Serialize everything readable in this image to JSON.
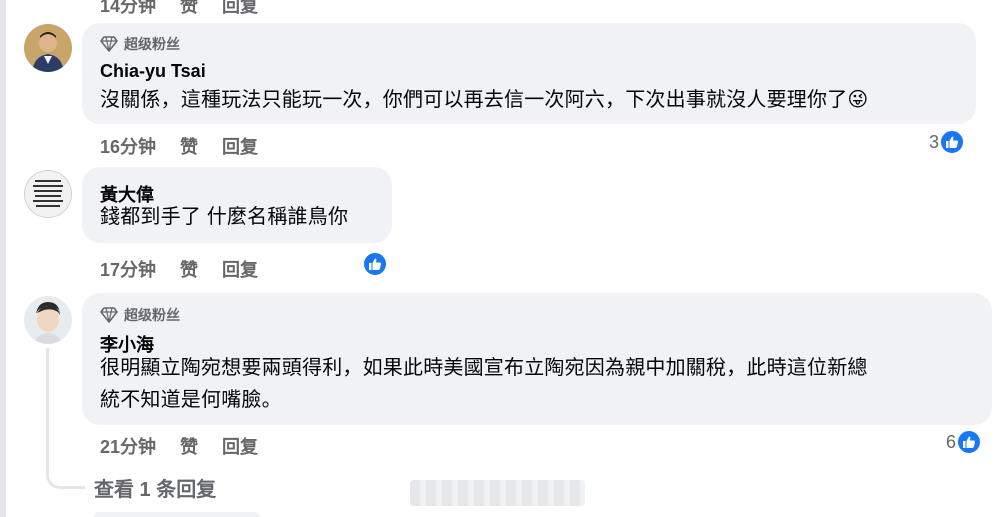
{
  "top_partial": {
    "time": "14分钟",
    "like": "赞",
    "reply": "回复"
  },
  "comments": [
    {
      "badge": "超级粉丝",
      "author": "Chia-yu Tsai",
      "text": "沒關係，這種玩法只能玩一次，你們可以再去信一次阿六，下次出事就沒人要理你了",
      "emoji": "😜",
      "time": "16分钟",
      "like": "赞",
      "reply": "回复",
      "reactions": "3"
    },
    {
      "author": "黃大偉",
      "text": "錢都到手了 什麼名稱誰鳥你",
      "time": "17分钟",
      "like": "赞",
      "reply": "回复"
    },
    {
      "badge": "超级粉丝",
      "author": "李小海",
      "text_line1": "很明顯立陶宛想要兩頭得利，如果此時美國宣布立陶宛因為親中加關稅，此時這位新總",
      "text_line2": "統不知道是何嘴臉。",
      "time": "21分钟",
      "like": "赞",
      "reply": "回复",
      "reactions": "6"
    }
  ],
  "view_replies": "查看 1 条回复",
  "colors": {
    "like_blue": "#1877f2",
    "bubble": "#f0f2f5",
    "meta": "#65676b"
  },
  "icons": {
    "badge": "diamond-icon",
    "like": "thumbs-up-icon"
  }
}
